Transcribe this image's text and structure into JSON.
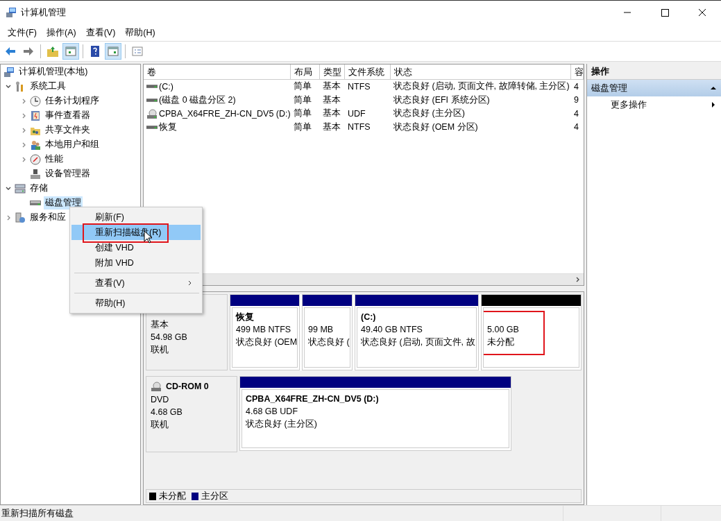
{
  "window": {
    "title": "计算机管理"
  },
  "menu": [
    "文件(F)",
    "操作(A)",
    "查看(V)",
    "帮助(H)"
  ],
  "toolbar": [
    {
      "kind": "back",
      "pressed": false
    },
    {
      "kind": "forward",
      "pressed": false
    },
    {
      "kind": "separator"
    },
    {
      "kind": "up",
      "pressed": false
    },
    {
      "kind": "tree",
      "pressed": true
    },
    {
      "kind": "separator"
    },
    {
      "kind": "help",
      "pressed": false
    },
    {
      "kind": "actions",
      "pressed": true
    },
    {
      "kind": "separator"
    },
    {
      "kind": "properties",
      "pressed": false
    }
  ],
  "tree": {
    "label": "计算机管理(本地)",
    "selected": false,
    "children": [
      {
        "label": "系统工具",
        "expanded": true,
        "selected": false,
        "children": [
          {
            "label": "任务计划程序",
            "expanded": false,
            "selected": false
          },
          {
            "label": "事件查看器",
            "expanded": false,
            "selected": false
          },
          {
            "label": "共享文件夹",
            "expanded": false,
            "selected": false
          },
          {
            "label": "本地用户和组",
            "expanded": false,
            "selected": false
          },
          {
            "label": "性能",
            "expanded": false,
            "selected": false
          },
          {
            "label": "设备管理器",
            "selected": false
          }
        ]
      },
      {
        "label": "存储",
        "expanded": true,
        "selected": false,
        "children": [
          {
            "label": "磁盘管理",
            "selected": true
          }
        ]
      },
      {
        "label": "服务和应",
        "expanded": false,
        "selected": false
      }
    ]
  },
  "table": {
    "columns": [
      "卷",
      "布局",
      "类型",
      "文件系统",
      "状态",
      "容"
    ],
    "rows": [
      {
        "kind": "disk",
        "cells": [
          " (C:)",
          "简单",
          "基本",
          "NTFS",
          "状态良好 (启动, 页面文件, 故障转储, 主分区)",
          "4"
        ]
      },
      {
        "kind": "disk",
        "cells": [
          "(磁盘 0 磁盘分区 2)",
          "简单",
          "基本",
          "",
          "状态良好 (EFI 系统分区)",
          "9"
        ]
      },
      {
        "kind": "cd",
        "cells": [
          "CPBA_X64FRE_ZH-CN_DV5 (D:)",
          "简单",
          "基本",
          "UDF",
          "状态良好 (主分区)",
          "4"
        ]
      },
      {
        "kind": "disk",
        "cells": [
          "恢复",
          "简单",
          "基本",
          "NTFS",
          "状态良好 (OEM 分区)",
          "4"
        ]
      }
    ]
  },
  "disks": [
    {
      "lines": [
        "基本",
        "54.98 GB",
        "联机"
      ],
      "partitions": [
        {
          "kind": "primary",
          "title": "恢复",
          "lines": [
            "499 MB NTFS",
            "状态良好 (OEM"
          ],
          "annotated": false
        },
        {
          "kind": "primary",
          "lines": [
            "99 MB",
            "状态良好 ("
          ],
          "annotated": false
        },
        {
          "kind": "primary",
          "title": " (C:)",
          "lines": [
            "49.40 GB NTFS",
            "状态良好 (启动, 页面文件, 故"
          ],
          "annotated": false
        },
        {
          "kind": "unallocated",
          "lines": [
            "5.00 GB",
            "未分配"
          ],
          "annotated": true
        }
      ]
    },
    {
      "kind": "cd",
      "title": "CD-ROM 0",
      "lines": [
        "DVD",
        "4.68 GB",
        "联机"
      ],
      "partitions": [
        {
          "kind": "primary",
          "title": "CPBA_X64FRE_ZH-CN_DV5  (D:)",
          "lines": [
            "4.68 GB UDF",
            "状态良好 (主分区)"
          ],
          "annotated": false
        }
      ]
    }
  ],
  "legend": [
    {
      "label": "未分配",
      "color": "#000000"
    },
    {
      "label": "主分区",
      "color": "#000080"
    }
  ],
  "actions": {
    "header": "操作",
    "section": {
      "label": "磁盘管理",
      "expanded": true
    },
    "items": [
      "更多操作"
    ]
  },
  "context_menu": [
    {
      "kind": "item",
      "label": "刷新(F)",
      "selected": false,
      "annotated": false
    },
    {
      "kind": "item",
      "label": "重新扫描磁盘(R)",
      "selected": true,
      "annotated": true
    },
    {
      "kind": "item",
      "label": "创建 VHD",
      "selected": false,
      "annotated": false
    },
    {
      "kind": "item",
      "label": "附加 VHD",
      "selected": false,
      "annotated": false
    },
    {
      "kind": "separator"
    },
    {
      "kind": "submenu",
      "label": "查看(V)",
      "selected": false,
      "annotated": false
    },
    {
      "kind": "separator"
    },
    {
      "kind": "item",
      "label": "帮助(H)",
      "selected": false,
      "annotated": false
    }
  ],
  "status_bar": "重新扫描所有磁盘"
}
